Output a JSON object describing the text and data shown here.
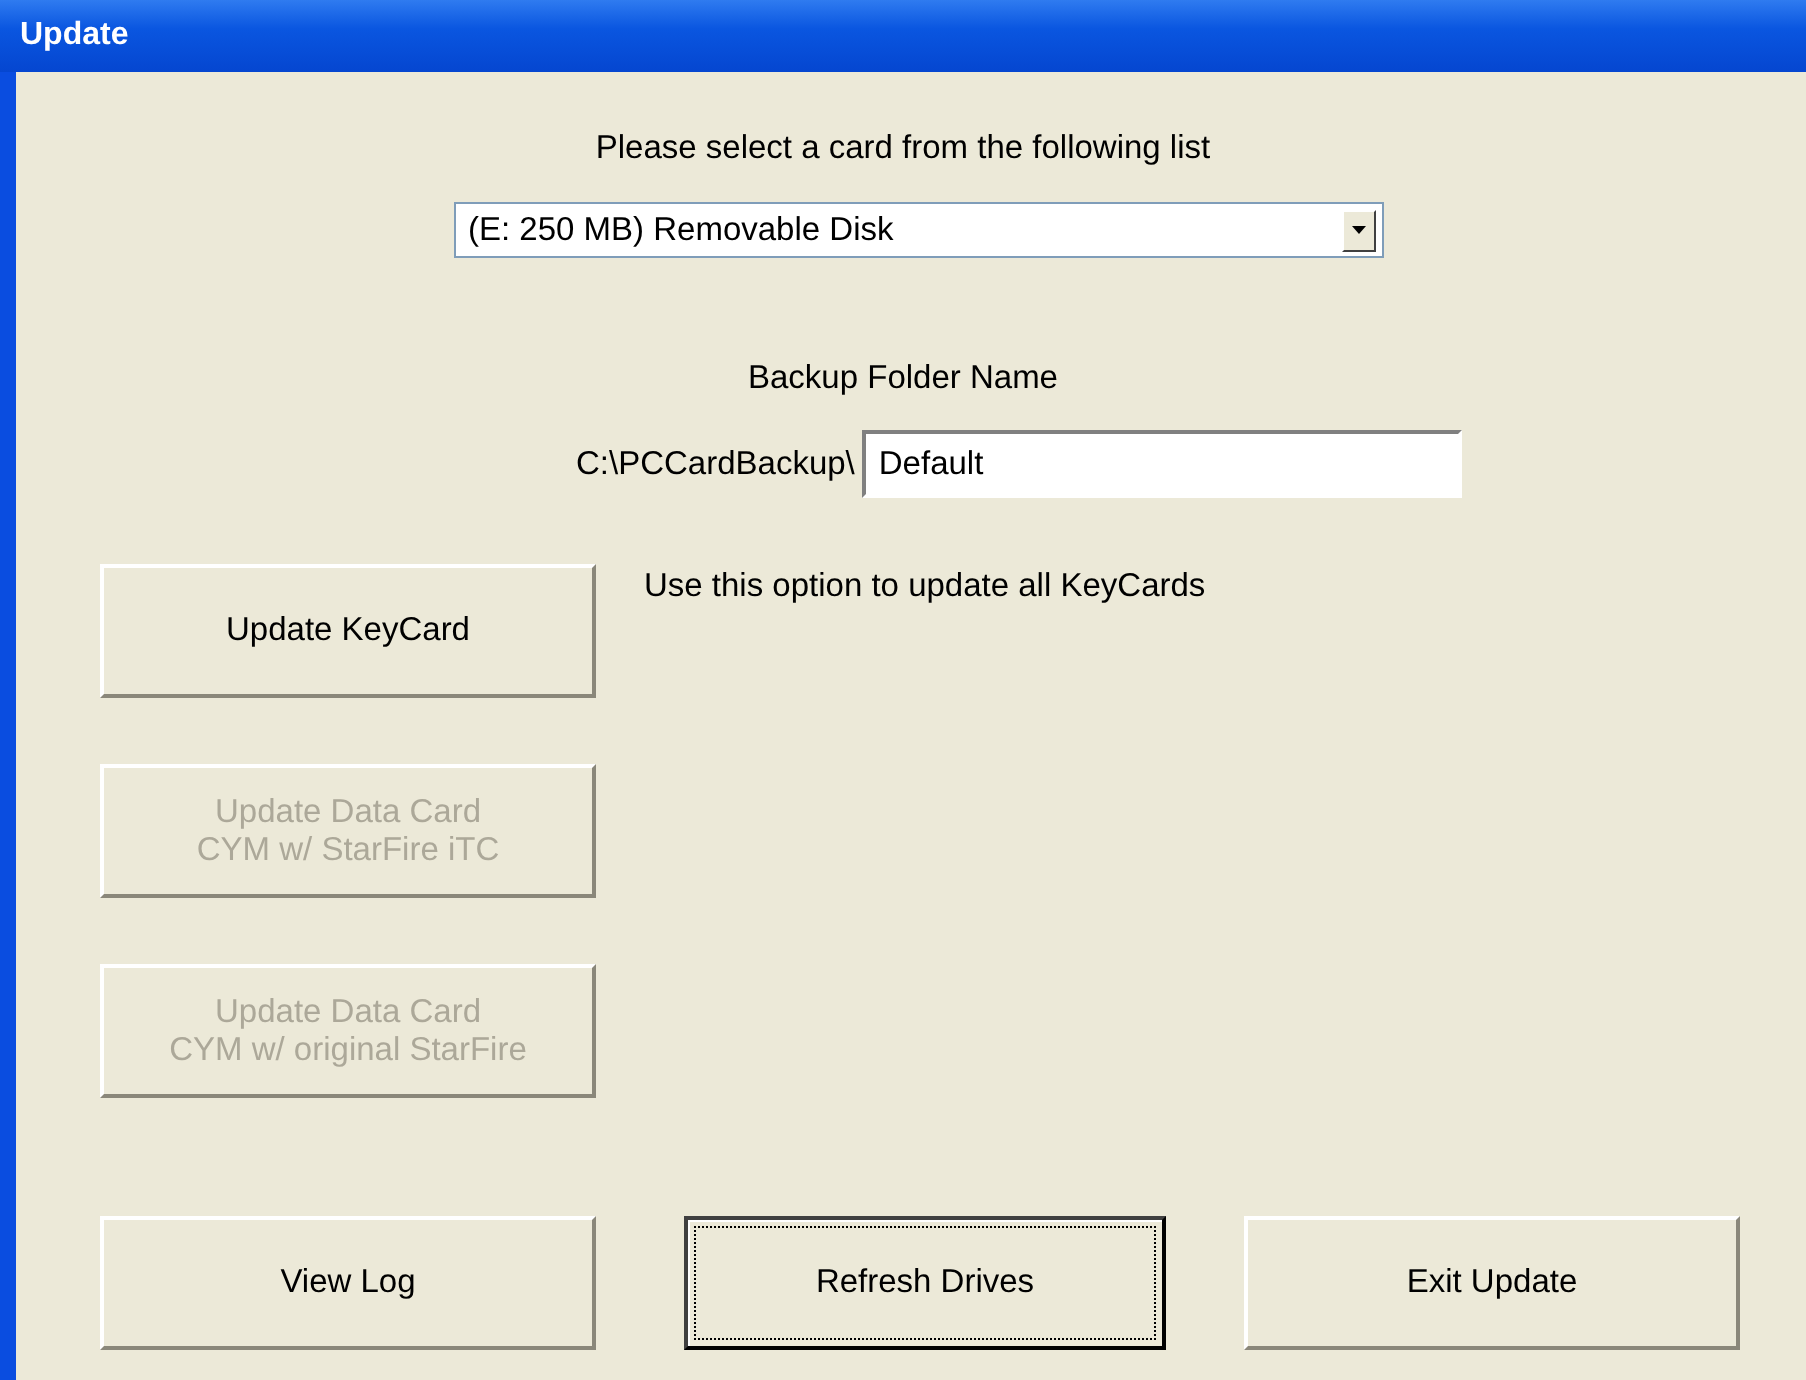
{
  "window": {
    "title": "Update"
  },
  "prompt": "Please select a card from the following list",
  "card_select": {
    "value": "(E: 250 MB) Removable Disk"
  },
  "backup_label": "Backup Folder Name",
  "path_prefix": "C:\\PCCardBackup\\",
  "folder_field": {
    "value": "Default"
  },
  "keycard_hint": "Use this option to update all KeyCards",
  "update_buttons": [
    {
      "lines": [
        "Update KeyCard"
      ],
      "disabled": false
    },
    {
      "lines": [
        "Update Data Card",
        "CYM w/ StarFire iTC"
      ],
      "disabled": true
    },
    {
      "lines": [
        "Update Data Card",
        "CYM w/ original StarFire"
      ],
      "disabled": true
    }
  ],
  "bottom_buttons": [
    {
      "label": "View Log",
      "focused": false
    },
    {
      "label": "Refresh Drives",
      "focused": true
    },
    {
      "label": "Exit Update",
      "focused": false
    }
  ]
}
